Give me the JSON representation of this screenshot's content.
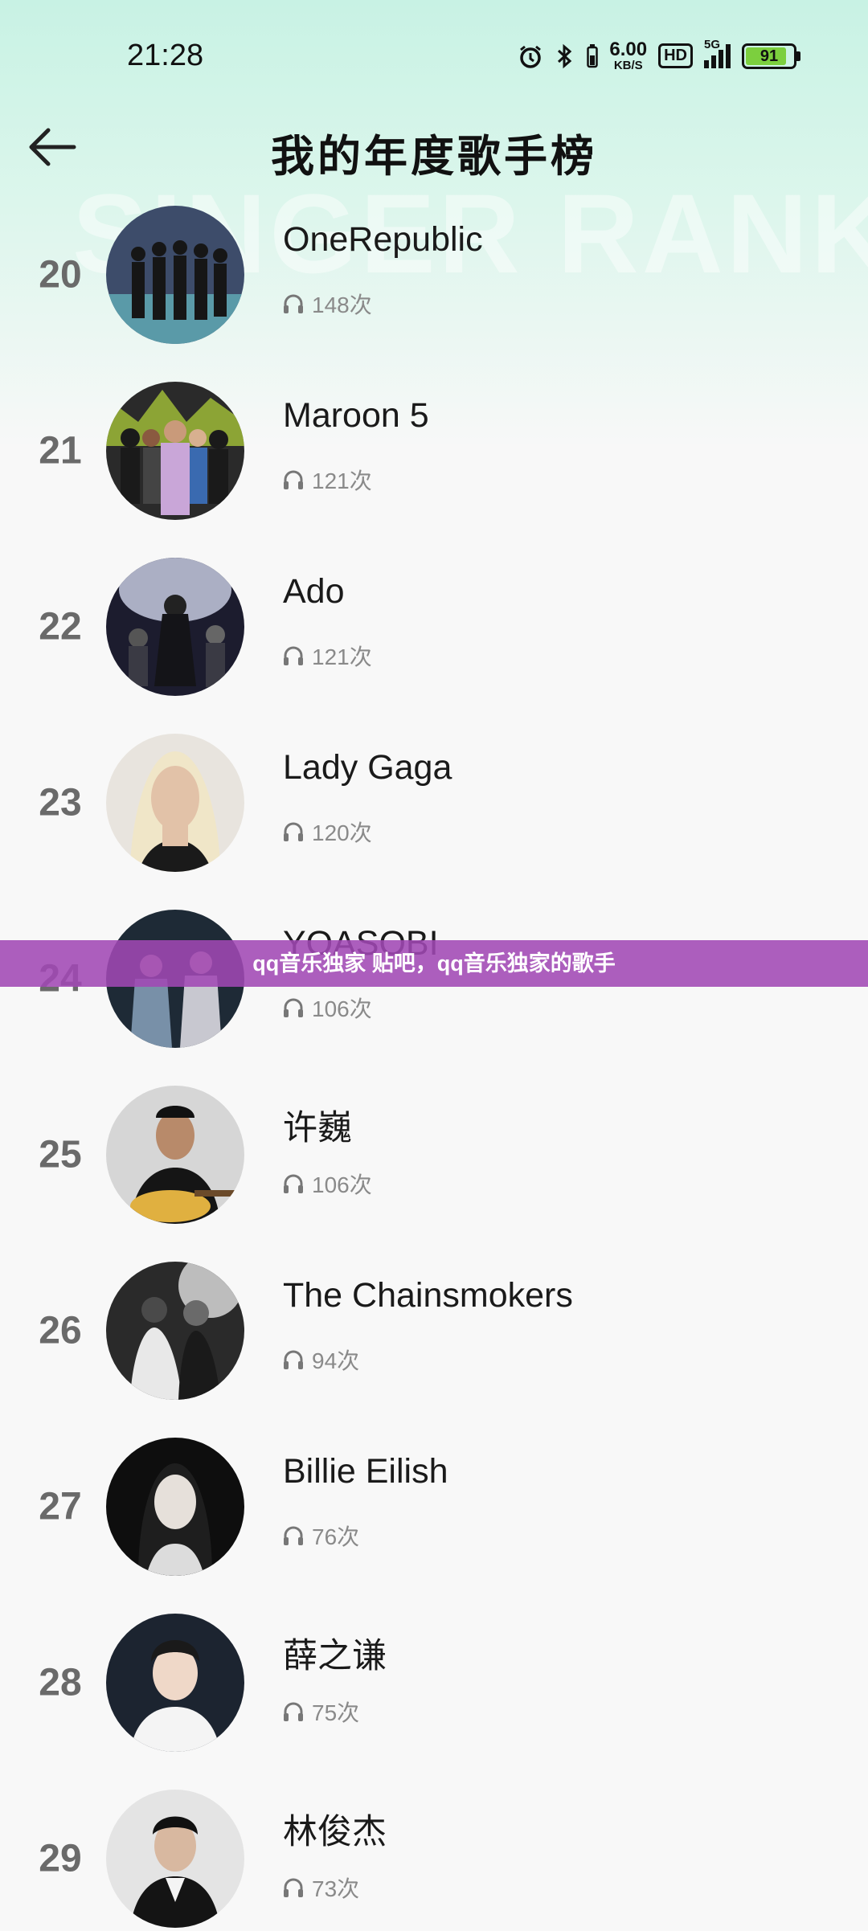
{
  "status_bar": {
    "time": "21:28",
    "net_speed_value": "6.00",
    "net_speed_unit": "KB/S",
    "hd_label": "HD",
    "signal_label": "5G",
    "battery": "91"
  },
  "header": {
    "title": "我的年度歌手榜",
    "watermark": "SINGER RANK"
  },
  "artists": [
    {
      "rank": "20",
      "name": "OneRepublic",
      "plays": "148次"
    },
    {
      "rank": "21",
      "name": "Maroon 5",
      "plays": "121次"
    },
    {
      "rank": "22",
      "name": "Ado",
      "plays": "121次"
    },
    {
      "rank": "23",
      "name": "Lady Gaga",
      "plays": "120次"
    },
    {
      "rank": "24",
      "name": "YOASOBI",
      "plays": "106次"
    },
    {
      "rank": "25",
      "name": "许巍",
      "plays": "106次"
    },
    {
      "rank": "26",
      "name": "The Chainsmokers",
      "plays": "94次"
    },
    {
      "rank": "27",
      "name": "Billie Eilish",
      "plays": "76次"
    },
    {
      "rank": "28",
      "name": "薛之谦",
      "plays": "75次"
    },
    {
      "rank": "29",
      "name": "林俊杰",
      "plays": "73次"
    }
  ],
  "banner": {
    "text": "qq音乐独家 贴吧，qq音乐独家的歌手"
  },
  "colors": {
    "banner_bg": "#a048b4",
    "rank_text": "#6a6a6a",
    "header_tint": "#c8f2e4"
  }
}
